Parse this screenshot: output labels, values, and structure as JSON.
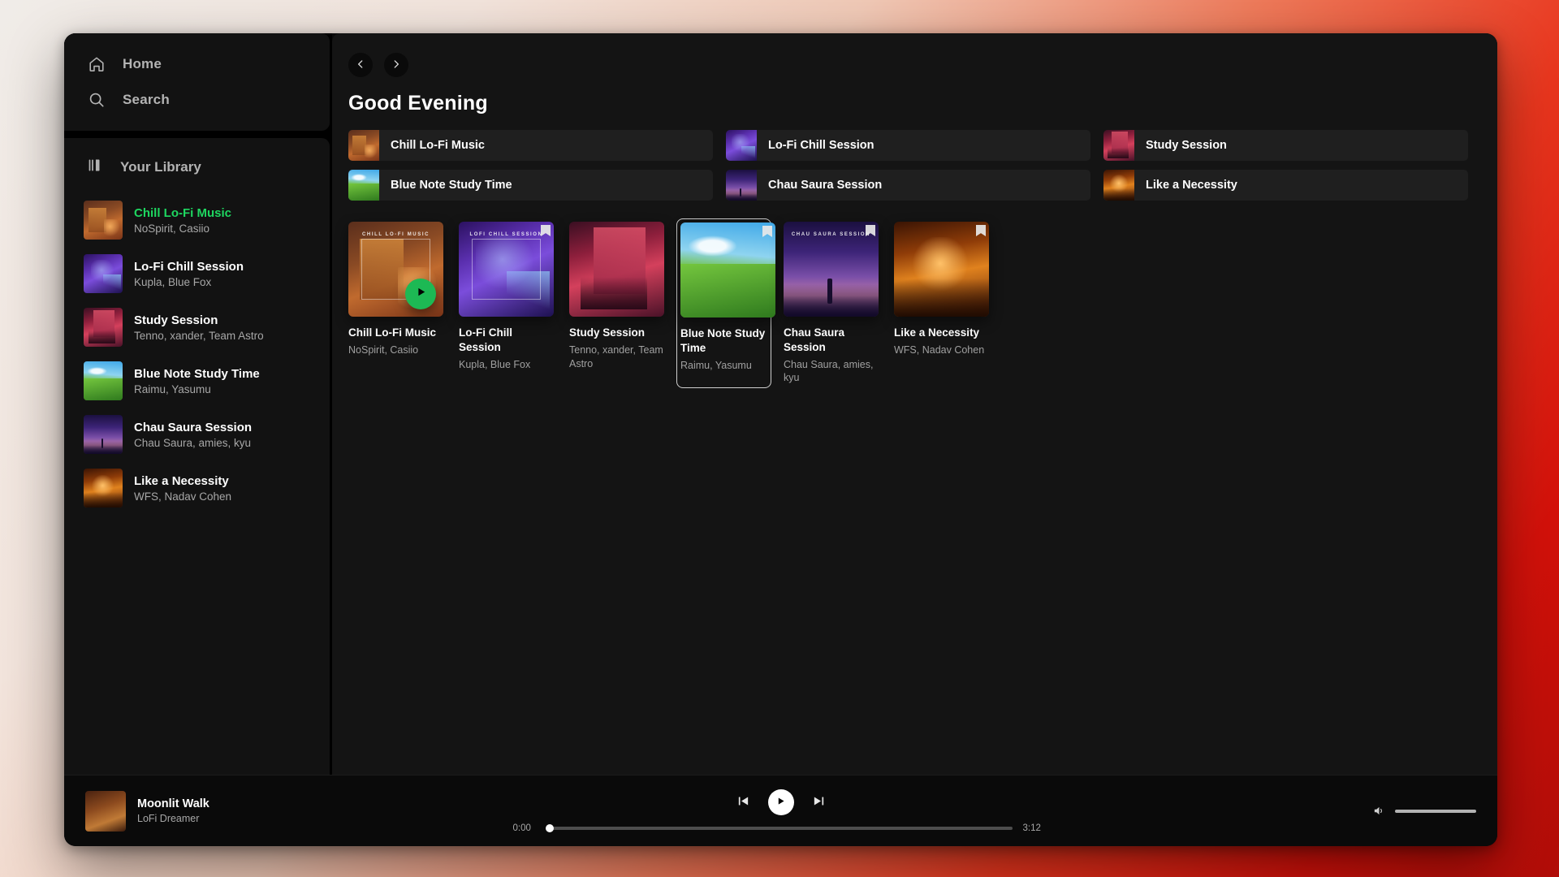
{
  "sidebar": {
    "nav": [
      {
        "label": "Home",
        "icon": "home-icon"
      },
      {
        "label": "Search",
        "icon": "search-icon"
      }
    ],
    "library_label": "Your Library",
    "library_icon": "library-icon",
    "items": [
      {
        "title": "Chill Lo-Fi Music",
        "artists": "NoSpirit, Casiio",
        "art": "art-chill",
        "active": true
      },
      {
        "title": "Lo-Fi Chill Session",
        "artists": "Kupla, Blue Fox",
        "art": "art-lofi",
        "active": false
      },
      {
        "title": "Study Session",
        "artists": "Tenno, xander, Team Astro",
        "art": "art-study",
        "active": false
      },
      {
        "title": "Blue Note Study Time",
        "artists": "Raimu, Yasumu",
        "art": "art-blue",
        "active": false
      },
      {
        "title": "Chau Saura Session",
        "artists": "Chau Saura, amies, kyu",
        "art": "art-chau",
        "active": false
      },
      {
        "title": "Like a Necessity",
        "artists": "WFS, Nadav Cohen",
        "art": "art-neces",
        "active": false
      }
    ]
  },
  "main": {
    "greeting": "Good Evening",
    "nav_back_icon": "chevron-left-icon",
    "nav_forward_icon": "chevron-right-icon",
    "quick_tiles": [
      {
        "label": "Chill Lo-Fi Music",
        "art": "art-chill"
      },
      {
        "label": "Lo-Fi Chill Session",
        "art": "art-lofi"
      },
      {
        "label": "Study Session",
        "art": "art-study"
      },
      {
        "label": "Blue Note Study Time",
        "art": "art-blue"
      },
      {
        "label": "Chau Saura Session",
        "art": "art-chau"
      },
      {
        "label": "Like a Necessity",
        "art": "art-neces"
      }
    ],
    "cards": [
      {
        "title": "Chill Lo-Fi Music",
        "artists": "NoSpirit, Casiio",
        "art": "art-chill",
        "caption": "CHILL LO-FI MUSIC",
        "playing": true,
        "selected": false,
        "badge": false
      },
      {
        "title": "Lo-Fi Chill Session",
        "artists": "Kupla, Blue Fox",
        "art": "art-lofi",
        "caption": "LOFI CHILL SESSION",
        "playing": false,
        "selected": false,
        "badge": true
      },
      {
        "title": "Study Session",
        "artists": "Tenno, xander, Team Astro",
        "art": "art-study",
        "caption": "",
        "playing": false,
        "selected": false,
        "badge": false
      },
      {
        "title": "Blue Note Study Time",
        "artists": "Raimu, Yasumu",
        "art": "art-blue",
        "caption": "",
        "playing": false,
        "selected": true,
        "badge": true
      },
      {
        "title": "Chau Saura Session",
        "artists": "Chau Saura, amies, kyu",
        "art": "art-chau",
        "caption": "CHAU SAURA SESSION",
        "playing": false,
        "selected": false,
        "badge": true
      },
      {
        "title": "Like a Necessity",
        "artists": "WFS, Nadav Cohen",
        "art": "art-neces",
        "caption": "",
        "playing": false,
        "selected": false,
        "badge": true
      }
    ]
  },
  "player": {
    "now_playing_title": "Moonlit Walk",
    "now_playing_artist": "LoFi Dreamer",
    "now_playing_art": "art-moonlit",
    "elapsed": "0:00",
    "duration": "3:12",
    "progress_percent": 0,
    "volume_percent": 100,
    "prev_icon": "skip-previous-icon",
    "play_icon": "play-icon",
    "next_icon": "skip-next-icon",
    "volume_icon": "volume-icon"
  },
  "colors": {
    "accent_green": "#1ed760",
    "play_button_green": "#1db954",
    "app_background": "#0a0a0a",
    "panel_background": "#121212",
    "main_background": "#141414"
  }
}
